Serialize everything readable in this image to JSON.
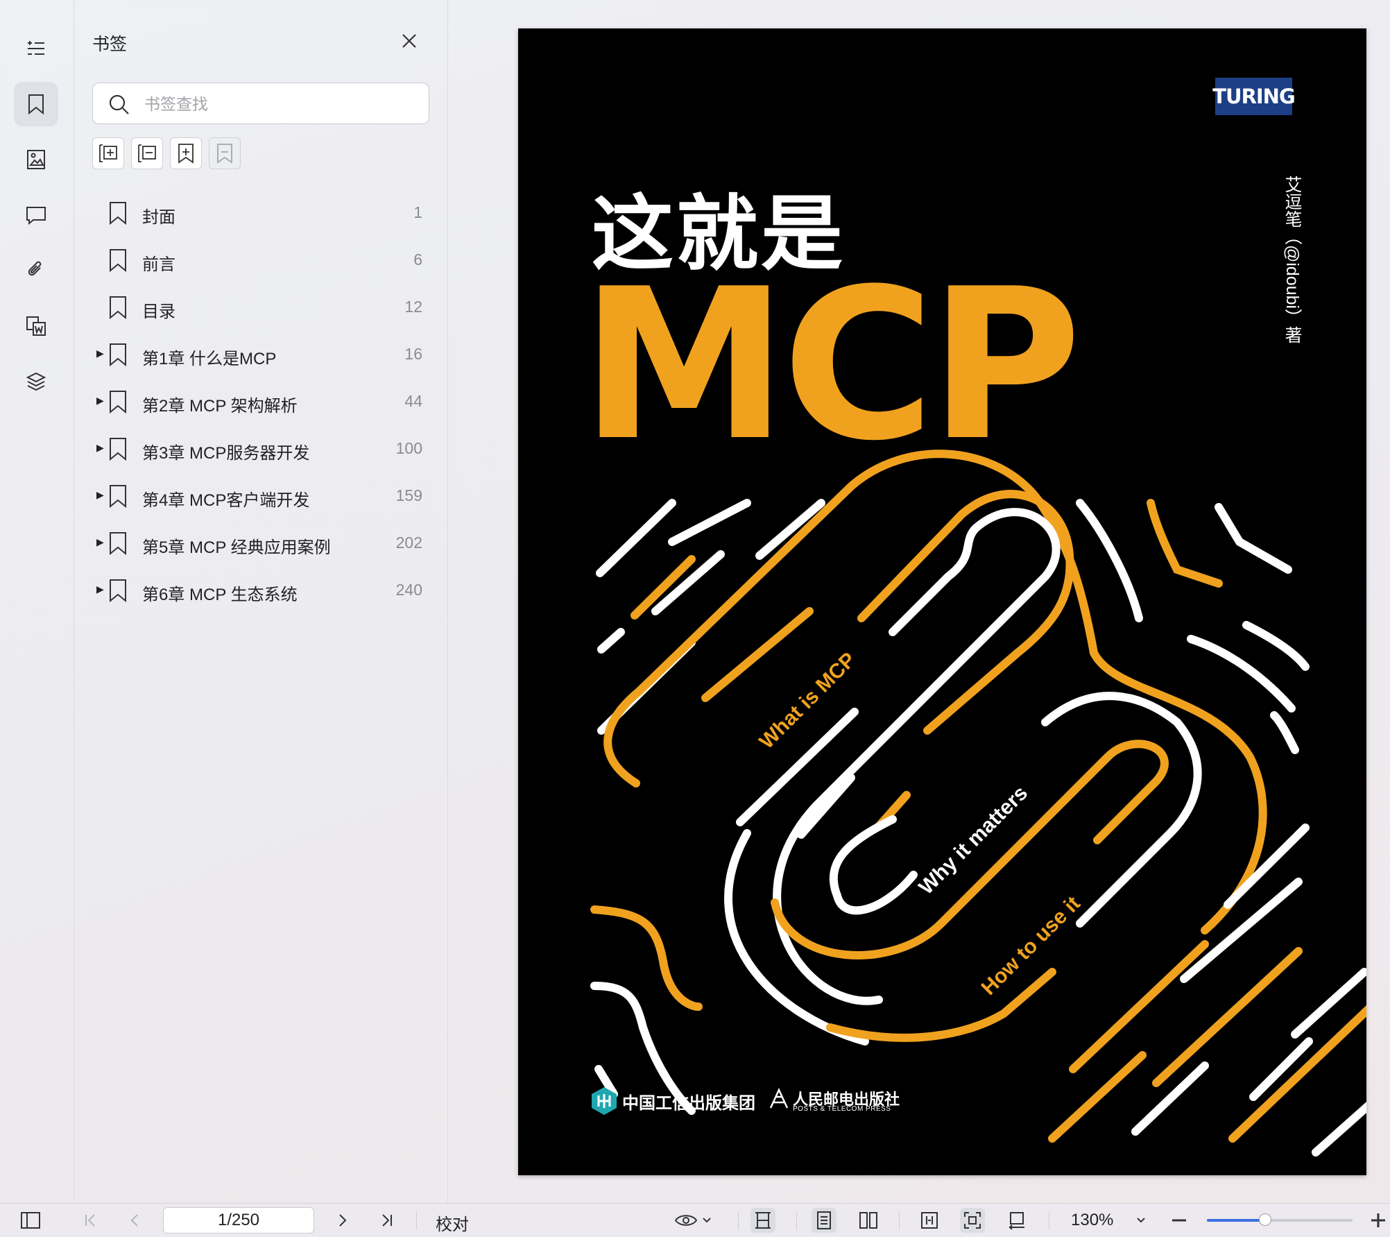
{
  "sidebar_panel": {
    "title": "书签",
    "search_placeholder": "书签查找",
    "bookmarks": [
      {
        "label": "封面",
        "page": "1",
        "expandable": false
      },
      {
        "label": "前言",
        "page": "6",
        "expandable": false
      },
      {
        "label": "目录",
        "page": "12",
        "expandable": false
      },
      {
        "label": "第1章 什么是MCP",
        "page": "16",
        "expandable": true
      },
      {
        "label": "第2章 MCP 架构解析",
        "page": "44",
        "expandable": true
      },
      {
        "label": "第3章 MCP服务器开发",
        "page": "100",
        "expandable": true
      },
      {
        "label": "第4章 MCP客户端开发",
        "page": "159",
        "expandable": true
      },
      {
        "label": "第5章 MCP 经典应用案例",
        "page": "202",
        "expandable": true
      },
      {
        "label": "第6章 MCP 生态系统",
        "page": "240",
        "expandable": true
      }
    ]
  },
  "document": {
    "brand_logo": "TURING",
    "title_cn": "这就是",
    "title_en": "MCP",
    "author": "艾逗笔（@idoubi）著",
    "tagline_1": "What is MCP",
    "tagline_2": "Why it matters",
    "tagline_3": "How to use it",
    "publisher_1": "中国工信出版集团",
    "publisher_2": "人民邮电出版社",
    "publisher_2_en": "POSTS & TELECOM PRESS",
    "colors": {
      "background": "#000000",
      "accent": "#f0a21f",
      "line": "#ffffff"
    }
  },
  "statusbar": {
    "page_indicator": "1/250",
    "proofread_label": "校对",
    "zoom_value": "130%",
    "zoom_slider_level": 0.4
  }
}
